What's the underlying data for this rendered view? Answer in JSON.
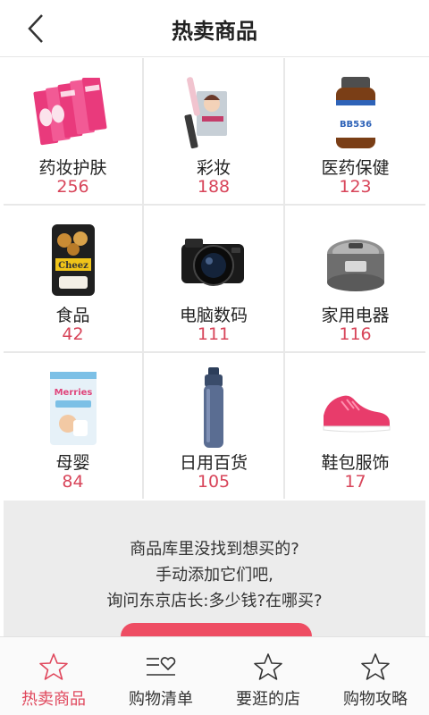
{
  "header": {
    "title": "热卖商品"
  },
  "categories": [
    {
      "name": "药妆护肤",
      "count": "256"
    },
    {
      "name": "彩妆",
      "count": "188"
    },
    {
      "name": "医药保健",
      "count": "123"
    },
    {
      "name": "食品",
      "count": "42"
    },
    {
      "name": "电脑数码",
      "count": "111"
    },
    {
      "name": "家用电器",
      "count": "116"
    },
    {
      "name": "母婴",
      "count": "84"
    },
    {
      "name": "日用百货",
      "count": "105"
    },
    {
      "name": "鞋包服饰",
      "count": "17"
    }
  ],
  "images": {
    "skincare": "BB536",
    "snack": "Cheez",
    "diaper": "Merries"
  },
  "promo": {
    "line1": "商品库里没找到想买的?",
    "line2": "手动添加它们吧,",
    "line3": "询问东京店长:多少钱?在哪买?"
  },
  "tabs": [
    {
      "label": "热卖商品",
      "icon": "star-icon",
      "active": true
    },
    {
      "label": "购物清单",
      "icon": "list-heart-icon",
      "active": false
    },
    {
      "label": "要逛的店",
      "icon": "star-icon",
      "active": false
    },
    {
      "label": "购物攻略",
      "icon": "star-icon",
      "active": false
    }
  ],
  "colors": {
    "accent": "#e0475c",
    "count": "#d8455a",
    "promo_bg": "#ececec",
    "button": "#ee4d63"
  }
}
